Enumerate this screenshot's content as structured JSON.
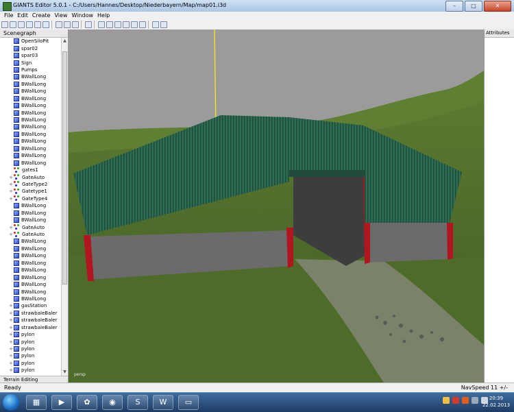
{
  "window": {
    "title": "GIANTS Editor 5.0.1 - C:/Users/Hannes/Desktop/Niederbayern/Map/map01.i3d",
    "min": "–",
    "max": "□",
    "close": "✕"
  },
  "menu": [
    "File",
    "Edit",
    "Create",
    "View",
    "Window",
    "Help"
  ],
  "sidebar": {
    "title": "Scenegraph",
    "items": [
      {
        "label": "OpenSiloPit",
        "icon": "cube",
        "exp": ""
      },
      {
        "label": "spar02",
        "icon": "cube",
        "exp": ""
      },
      {
        "label": "spar03",
        "icon": "cube",
        "exp": ""
      },
      {
        "label": "Sign",
        "icon": "cube",
        "exp": ""
      },
      {
        "label": "Pumps",
        "icon": "cube",
        "exp": ""
      },
      {
        "label": "BWallLong",
        "icon": "cube",
        "exp": ""
      },
      {
        "label": "BWallLong",
        "icon": "cube",
        "exp": ""
      },
      {
        "label": "BWallLong",
        "icon": "cube",
        "exp": ""
      },
      {
        "label": "BWallLong",
        "icon": "cube",
        "exp": ""
      },
      {
        "label": "BWallLong",
        "icon": "cube",
        "exp": ""
      },
      {
        "label": "BWallLong",
        "icon": "cube",
        "exp": ""
      },
      {
        "label": "BWallLong",
        "icon": "cube",
        "exp": ""
      },
      {
        "label": "BWallLong",
        "icon": "cube",
        "exp": ""
      },
      {
        "label": "BWallLong",
        "icon": "cube",
        "exp": ""
      },
      {
        "label": "BWallLong",
        "icon": "cube",
        "exp": ""
      },
      {
        "label": "BWallLong",
        "icon": "cube",
        "exp": ""
      },
      {
        "label": "BWallLong",
        "icon": "cube",
        "exp": ""
      },
      {
        "label": "BWallLong",
        "icon": "cube",
        "exp": ""
      },
      {
        "label": "gates1",
        "icon": "tg",
        "exp": ""
      },
      {
        "label": "GateAuto",
        "icon": "tg",
        "exp": "+"
      },
      {
        "label": "GateType2",
        "icon": "tg",
        "exp": "+"
      },
      {
        "label": "Gatetype1",
        "icon": "tg",
        "exp": "+"
      },
      {
        "label": "GateType4",
        "icon": "tg",
        "exp": "+"
      },
      {
        "label": "BWallLong",
        "icon": "cube",
        "exp": ""
      },
      {
        "label": "BWallLong",
        "icon": "cube",
        "exp": ""
      },
      {
        "label": "BWallLong",
        "icon": "cube",
        "exp": ""
      },
      {
        "label": "GateAuto",
        "icon": "tg",
        "exp": "+"
      },
      {
        "label": "GateAuto",
        "icon": "tg",
        "exp": "+"
      },
      {
        "label": "BWallLong",
        "icon": "cube",
        "exp": ""
      },
      {
        "label": "BWallLong",
        "icon": "cube",
        "exp": ""
      },
      {
        "label": "BWallLong",
        "icon": "cube",
        "exp": ""
      },
      {
        "label": "BWallLong",
        "icon": "cube",
        "exp": ""
      },
      {
        "label": "BWallLong",
        "icon": "cube",
        "exp": ""
      },
      {
        "label": "BWallLong",
        "icon": "cube",
        "exp": ""
      },
      {
        "label": "BWallLong",
        "icon": "cube",
        "exp": ""
      },
      {
        "label": "BWallLong",
        "icon": "cube",
        "exp": ""
      },
      {
        "label": "BWallLong",
        "icon": "cube",
        "exp": ""
      },
      {
        "label": "gasStation",
        "icon": "cube",
        "exp": "+"
      },
      {
        "label": "strawbaleBaler",
        "icon": "cube",
        "exp": "+"
      },
      {
        "label": "strawbaleBaler",
        "icon": "cube",
        "exp": "+"
      },
      {
        "label": "strawbaleBaler",
        "icon": "cube",
        "exp": "+"
      },
      {
        "label": "pylon",
        "icon": "cube",
        "exp": "+"
      },
      {
        "label": "pylon",
        "icon": "cube",
        "exp": "+"
      },
      {
        "label": "pylon",
        "icon": "cube",
        "exp": "+"
      },
      {
        "label": "pylon",
        "icon": "cube",
        "exp": "+"
      },
      {
        "label": "pylon",
        "icon": "cube",
        "exp": "+"
      },
      {
        "label": "pylon",
        "icon": "cube",
        "exp": "+"
      }
    ],
    "terrain_tab": "Terrain Editing"
  },
  "viewport": {
    "camera_label": "persp"
  },
  "attributes": {
    "title": "Attributes"
  },
  "status": {
    "left": "Ready",
    "right": "NavSpeed 11 +/-"
  },
  "taskbar": {
    "apps": [
      {
        "name": "explorer",
        "glyph": "▦"
      },
      {
        "name": "media-player",
        "glyph": "▶"
      },
      {
        "name": "giants-editor",
        "glyph": "✿"
      },
      {
        "name": "firefox",
        "glyph": "◉"
      },
      {
        "name": "skype",
        "glyph": "S"
      },
      {
        "name": "word",
        "glyph": "W"
      },
      {
        "name": "folder",
        "glyph": "▭"
      }
    ],
    "time": "20:39",
    "date": "22.02.2013"
  },
  "colors": {
    "roof": "#2e6b53",
    "wall": "#6b6b6b",
    "beam": "#b1151f",
    "grass": "#4f6b2a",
    "sky": "#9b9b9b"
  }
}
